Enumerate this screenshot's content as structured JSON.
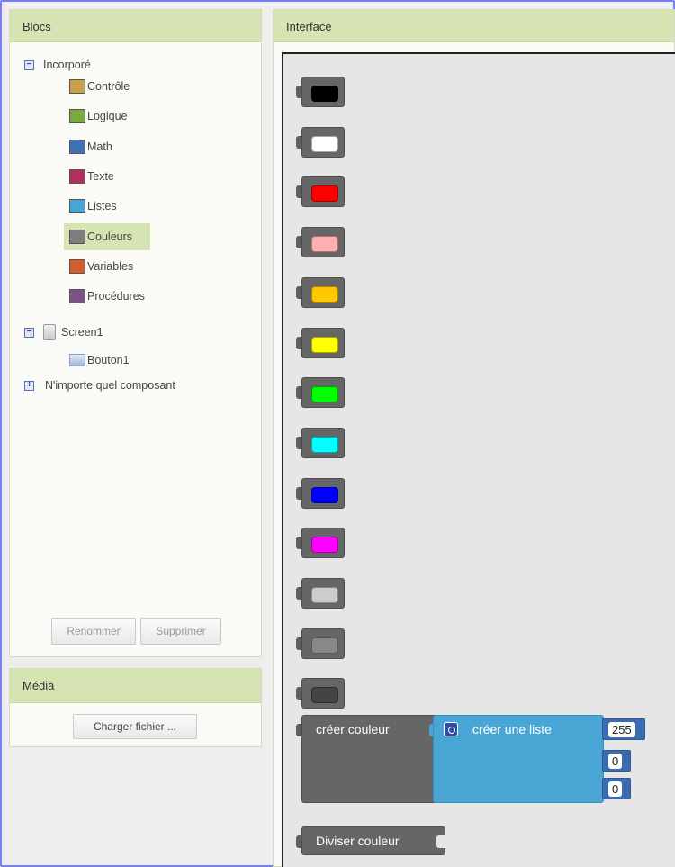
{
  "blocs_panel": {
    "title": "Blocs",
    "tree": {
      "builtin": {
        "label": "Incorporé",
        "items": [
          {
            "label": "Contrôle",
            "color": "#c8a047",
            "icon": "control-swatch-icon"
          },
          {
            "label": "Logique",
            "color": "#77ab41",
            "icon": "logic-swatch-icon"
          },
          {
            "label": "Math",
            "color": "#3f71b5",
            "icon": "math-swatch-icon"
          },
          {
            "label": "Texte",
            "color": "#b32d5e",
            "icon": "text-swatch-icon"
          },
          {
            "label": "Listes",
            "color": "#49a6d4",
            "icon": "lists-swatch-icon"
          },
          {
            "label": "Couleurs",
            "color": "#7d7d7d",
            "icon": "colors-swatch-icon",
            "selected": true
          },
          {
            "label": "Variables",
            "color": "#d05f2d",
            "icon": "variables-swatch-icon"
          },
          {
            "label": "Procédures",
            "color": "#7c5385",
            "icon": "procedures-swatch-icon"
          }
        ]
      },
      "screen": {
        "label": "Screen1",
        "children": [
          {
            "label": "Bouton1"
          }
        ]
      },
      "any_component": {
        "label": "N'importe quel composant"
      }
    },
    "buttons": {
      "rename": "Renommer",
      "delete": "Supprimer"
    }
  },
  "media_panel": {
    "title": "Média",
    "upload_button": "Charger fichier ..."
  },
  "interface_panel": {
    "title": "Interface",
    "color_blocks": [
      {
        "name": "black",
        "color": "#000000"
      },
      {
        "name": "white",
        "color": "#ffffff"
      },
      {
        "name": "red",
        "color": "#ff0000"
      },
      {
        "name": "pink",
        "color": "#ffafaf"
      },
      {
        "name": "orange",
        "color": "#ffc800"
      },
      {
        "name": "yellow",
        "color": "#ffff00"
      },
      {
        "name": "green",
        "color": "#00ff00"
      },
      {
        "name": "cyan",
        "color": "#00ffff"
      },
      {
        "name": "blue",
        "color": "#0000ff"
      },
      {
        "name": "magenta",
        "color": "#ff00ff"
      },
      {
        "name": "light-gray",
        "color": "#cccccc"
      },
      {
        "name": "gray",
        "color": "#888888"
      },
      {
        "name": "dark-gray",
        "color": "#444444"
      }
    ],
    "make_color_block": {
      "label": "créer couleur",
      "list_label": "créer une liste",
      "values": [
        "255",
        "0",
        "0"
      ]
    },
    "split_color_block": {
      "label": "Diviser couleur"
    }
  }
}
